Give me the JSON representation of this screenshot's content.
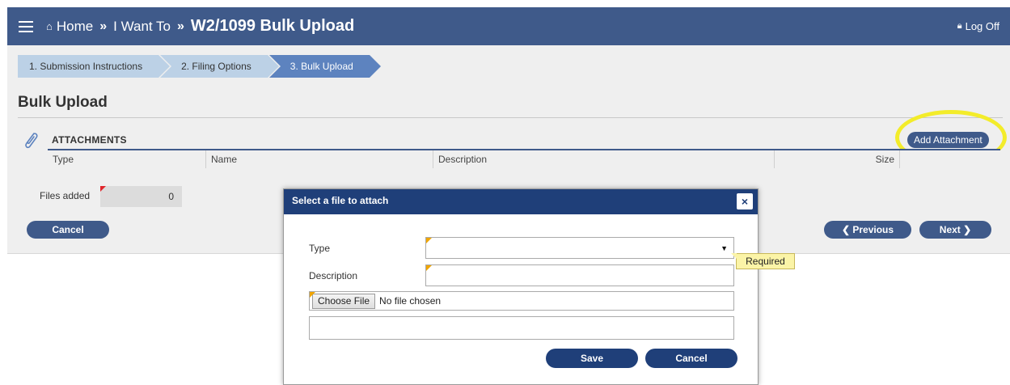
{
  "header": {
    "home_label": "Home",
    "crumb_sep": "»",
    "i_want_to_label": "I Want To",
    "current_page": "W2/1099 Bulk Upload",
    "logoff_label": "Log Off",
    "bg_color": "#3f5a8a"
  },
  "steps": [
    {
      "label": "1. Submission Instructions",
      "active": false
    },
    {
      "label": "2. Filing Options",
      "active": false
    },
    {
      "label": "3. Bulk Upload",
      "active": true
    }
  ],
  "page": {
    "title": "Bulk Upload",
    "attachments_label": "ATTACHMENTS",
    "add_attachment_label": "Add Attachment",
    "columns": [
      "Type",
      "Name",
      "Description",
      "Size"
    ],
    "files_added_label": "Files added",
    "files_added_value": "0",
    "cancel_label": "Cancel",
    "previous_label": "Previous",
    "next_label": "Next"
  },
  "modal": {
    "title": "Select a file to attach",
    "close_glyph": "×",
    "type_label": "Type",
    "type_value": "",
    "description_label": "Description",
    "description_value": "",
    "choose_file_label": "Choose File",
    "file_status": "No file chosen",
    "extra_value": "",
    "required_tooltip": "Required",
    "save_label": "Save",
    "cancel_label": "Cancel"
  },
  "icons": {
    "menu": "hamburger-icon",
    "home": "home-icon",
    "lock": "lock-icon",
    "attachment": "paperclip-icon",
    "prev": "chevron-left-icon",
    "next": "chevron-right-icon",
    "close": "close-icon",
    "caret": "caret-down-icon"
  }
}
